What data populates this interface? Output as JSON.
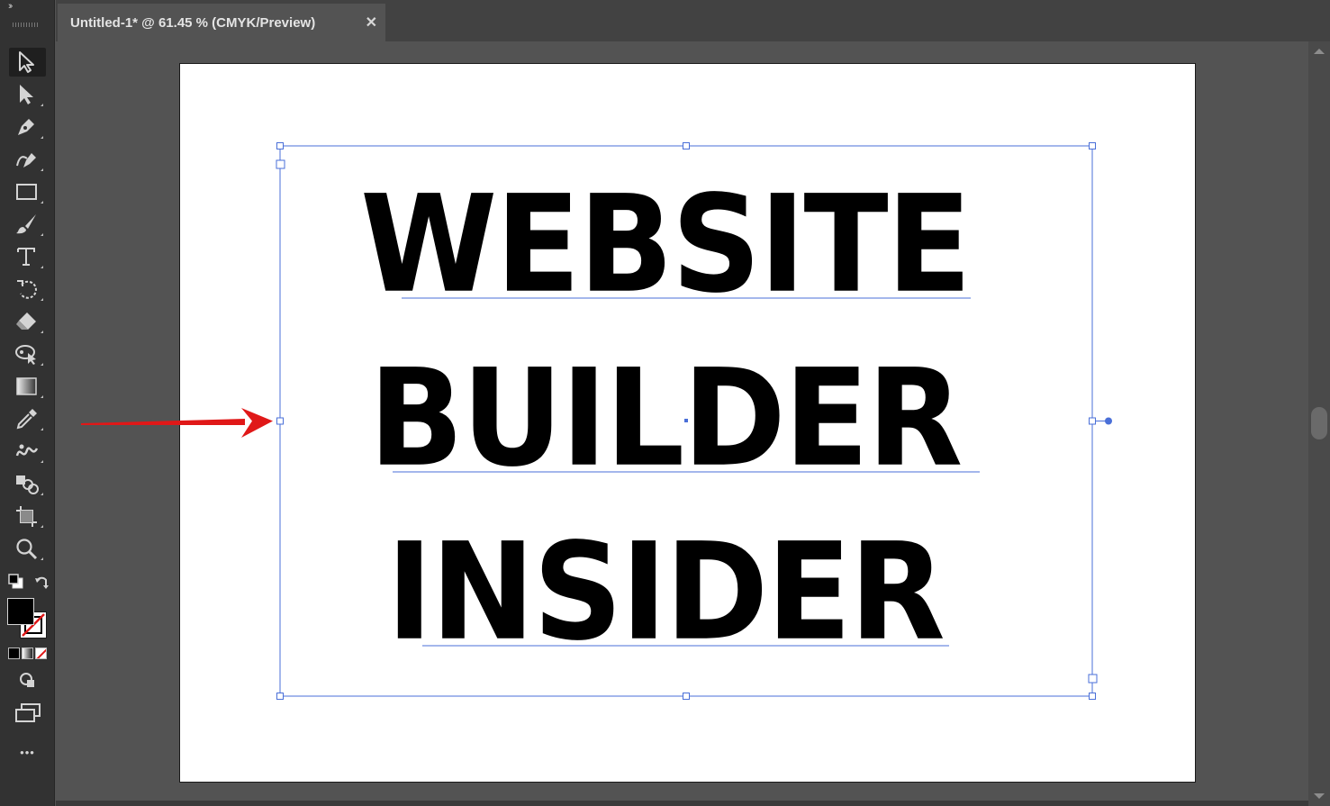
{
  "window": {
    "toolbar_collapse": "››",
    "tab": {
      "title": "Untitled-1* @ 61.45 % (CMYK/Preview)",
      "close": "✕"
    }
  },
  "toolbar": {
    "tools": [
      {
        "name": "selection-tool",
        "icon": "selection-arrow-icon",
        "active": true
      },
      {
        "name": "direct-selection-tool",
        "icon": "direct-selection-arrow-icon"
      },
      {
        "name": "pen-tool",
        "icon": "pen-icon"
      },
      {
        "name": "curvature-tool",
        "icon": "curvature-icon"
      },
      {
        "name": "rectangle-tool",
        "icon": "rectangle-icon"
      },
      {
        "name": "paintbrush-tool",
        "icon": "paintbrush-icon"
      },
      {
        "name": "type-tool",
        "icon": "type-icon"
      },
      {
        "name": "rotate-tool",
        "icon": "rotate-icon"
      },
      {
        "name": "eraser-tool",
        "icon": "eraser-icon"
      },
      {
        "name": "puppet-warp-tool",
        "icon": "puppet-warp-icon"
      },
      {
        "name": "gradient-tool",
        "icon": "gradient-icon"
      },
      {
        "name": "eyedropper-tool",
        "icon": "eyedropper-icon"
      },
      {
        "name": "blend-tool",
        "icon": "blend-icon"
      },
      {
        "name": "shape-builder-tool",
        "icon": "shape-builder-icon"
      },
      {
        "name": "artboard-tool",
        "icon": "artboard-icon"
      },
      {
        "name": "zoom-tool",
        "icon": "zoom-icon"
      }
    ],
    "fill_color": "#000000",
    "stroke": "none",
    "more_tools": "•••"
  },
  "artwork": {
    "lines": [
      "WEBSITE",
      "BUILDER",
      "INSIDER"
    ],
    "text_color": "#000000"
  },
  "colors": {
    "selection": "#4a6fd8",
    "annotation_arrow": "#e01818",
    "app_bg": "#535353",
    "toolbar_bg": "#323232"
  }
}
